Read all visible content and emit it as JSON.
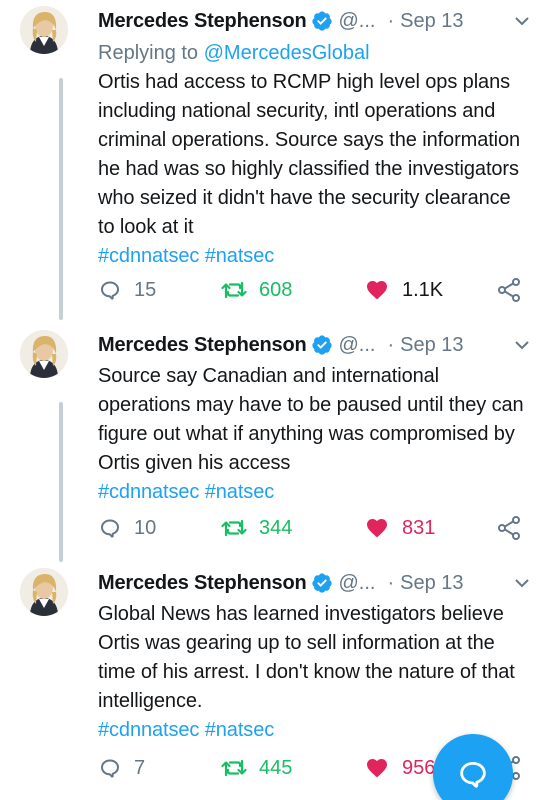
{
  "tweets": [
    {
      "author": "Mercedes Stephenson",
      "handle": "@...",
      "separator": "·",
      "date": "Sep 13",
      "reply_prefix": "Replying to ",
      "reply_handle": "@MercedesGlobal",
      "text": "Ortis had access to RCMP high level ops plans including national security, intl operations and criminal operations. Source says the information he had was so highly classified the investigators who seized it didn't have the security clearance to look at it",
      "hashtags": [
        "#cdnnatsec",
        "#natsec"
      ],
      "replies": "15",
      "retweets": "608",
      "likes": "1.1K"
    },
    {
      "author": "Mercedes Stephenson",
      "handle": "@...",
      "separator": "·",
      "date": "Sep 13",
      "text": "Source say Canadian and international operations may have to be paused until they can figure out what if anything was compromised by Ortis given his access",
      "hashtags": [
        "#cdnnatsec",
        "#natsec"
      ],
      "replies": "10",
      "retweets": "344",
      "likes": "831"
    },
    {
      "author": "Mercedes Stephenson",
      "handle": "@...",
      "separator": "·",
      "date": "Sep 13",
      "text": "Global News has learned investigators believe Ortis was gearing up to sell information at the time of his arrest. I don't know the nature of that intelligence.",
      "hashtags": [
        "#cdnnatsec",
        "#natsec"
      ],
      "replies": "7",
      "retweets": "445",
      "likes": "956"
    }
  ],
  "icons": {
    "verified": "verified-badge-icon",
    "chevron": "chevron-down-icon",
    "reply": "reply-icon",
    "retweet": "retweet-icon",
    "like": "heart-icon",
    "share": "share-icon",
    "compose": "compose-reply-icon"
  },
  "colors": {
    "accent": "#1da1f2",
    "retweet_green": "#17bf63",
    "like_red": "#e0245e",
    "muted": "#657786"
  }
}
